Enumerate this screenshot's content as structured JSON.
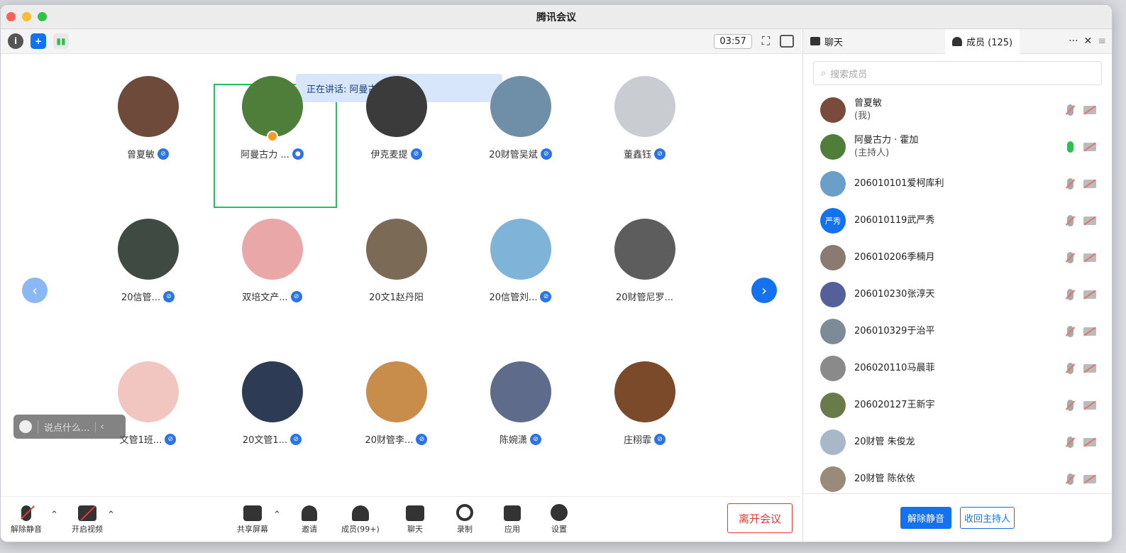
{
  "window": {
    "title": "腾讯会议"
  },
  "toolbar": {
    "timer": "03:57",
    "info_icon": "info-icon",
    "shield_icon": "shield-icon",
    "signal_icon": "signal-icon"
  },
  "speaking": {
    "text": "正在讲话: 阿曼古力 · 霍加;"
  },
  "tiles": [
    {
      "name": "曾夏敏",
      "color": "#6e4a3a",
      "mic": true
    },
    {
      "name": "阿曼古力 ...",
      "color": "#4f7d3a",
      "mic": true,
      "host": true,
      "speaking": true
    },
    {
      "name": "伊克麦提",
      "color": "#3b3b3b",
      "mic": true
    },
    {
      "name": "20财管吴斌",
      "color": "#6f8fa8",
      "mic": true
    },
    {
      "name": "董鑫钰",
      "color": "#c9cdd1",
      "mic": true
    },
    {
      "name": "20信管...",
      "color": "#3f4a42",
      "mic": true
    },
    {
      "name": "双培文产...",
      "color": "#e9a7a7",
      "mic": true
    },
    {
      "name": "20文1赵丹阳",
      "color": "#7a6a56",
      "mic": false
    },
    {
      "name": "20信管刘...",
      "color": "#7fb4d8",
      "mic": true
    },
    {
      "name": "20财管尼罗...",
      "color": "#5d5d5d",
      "mic": false
    },
    {
      "name": "文管1班...",
      "color": "#f2c6c0",
      "mic": true
    },
    {
      "name": "20文管1...",
      "color": "#2d3b55",
      "mic": true
    },
    {
      "name": "20财管李...",
      "color": "#c88d4a",
      "mic": true
    },
    {
      "name": "陈婉潇",
      "color": "#5f6b8a",
      "mic": true
    },
    {
      "name": "庄栩霏",
      "color": "#7b4a2a",
      "mic": true
    }
  ],
  "chatbar": {
    "placeholder": "说点什么..."
  },
  "bottom": {
    "unmute": "解除静音",
    "video": "开启视频",
    "share": "共享屏幕",
    "invite": "邀请",
    "members": "成员(99+)",
    "chat": "聊天",
    "record": "录制",
    "apps": "应用",
    "settings": "设置",
    "leave": "离开会议"
  },
  "side": {
    "tab_chat": "聊天",
    "tab_members": "成员 (125)",
    "more": "···",
    "close": "✕",
    "search_placeholder": "搜索成员",
    "members": [
      {
        "name": "曾夏敏",
        "sub": "(我)",
        "color": "#7a4b3a",
        "initials": "",
        "mic_on": false
      },
      {
        "name": "阿曼古力 · 霍加",
        "sub": "(主持人)",
        "color": "#4f7d3a",
        "initials": "",
        "mic_on": true
      },
      {
        "name": "206010101爱柯库利",
        "sub": "",
        "color": "#6aa0c8",
        "initials": "",
        "mic_on": false
      },
      {
        "name": "206010119武严秀",
        "sub": "",
        "color": "#1472ef",
        "initials": "严秀",
        "mic_on": false
      },
      {
        "name": "206010206季楠月",
        "sub": "",
        "color": "#8a7a70",
        "initials": "",
        "mic_on": false
      },
      {
        "name": "206010230张淳天",
        "sub": "",
        "color": "#55609a",
        "initials": "",
        "mic_on": false
      },
      {
        "name": "206010329于治平",
        "sub": "",
        "color": "#7d8a98",
        "initials": "",
        "mic_on": false
      },
      {
        "name": "206020110马晨菲",
        "sub": "",
        "color": "#8a8a8a",
        "initials": "",
        "mic_on": false
      },
      {
        "name": "206020127王新宇",
        "sub": "",
        "color": "#6b7a4a",
        "initials": "",
        "mic_on": false
      },
      {
        "name": "20财管  朱俊龙",
        "sub": "",
        "color": "#a8b8c8",
        "initials": "",
        "mic_on": false
      },
      {
        "name": "20财管 陈依依",
        "sub": "",
        "color": "#9a8a7a",
        "initials": "",
        "mic_on": false
      }
    ],
    "unmute_all": "解除静音",
    "reclaim_host": "收回主持人"
  }
}
